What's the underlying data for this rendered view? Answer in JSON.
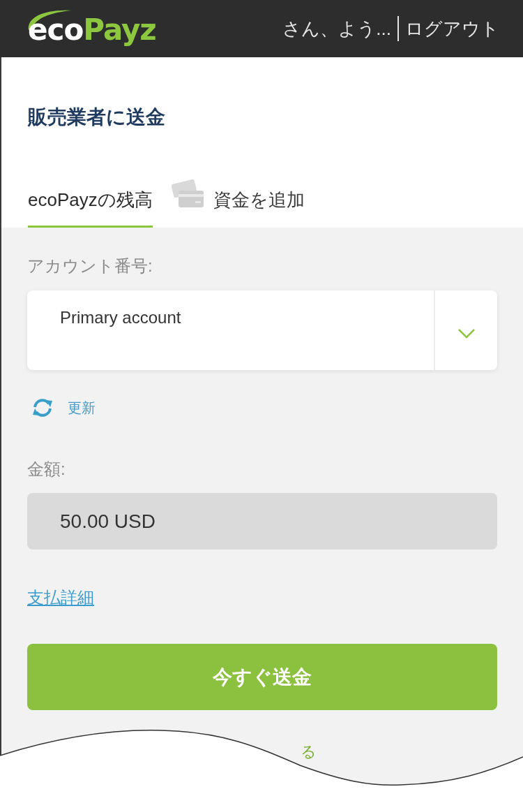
{
  "header": {
    "logo": [
      "eco",
      "Payz"
    ],
    "greeting": "さん、よう...",
    "logout": "ログアウト"
  },
  "title": "販売業者に送金",
  "tabs": [
    {
      "label": "ecoPayzの残高",
      "selected": true,
      "kind": "plain"
    },
    {
      "label": "資金を追加",
      "selected": false,
      "kind": "with_icon"
    }
  ],
  "form": {
    "account": {
      "label": "アカウント番号:",
      "value": "Primary account"
    },
    "refresh": "更新",
    "amount": {
      "label": "金額:",
      "value": "50.00 USD",
      "readonly": true
    },
    "details_link": "支払詳細",
    "submit": "今すぐ送金"
  },
  "cut_off_link": "る"
}
